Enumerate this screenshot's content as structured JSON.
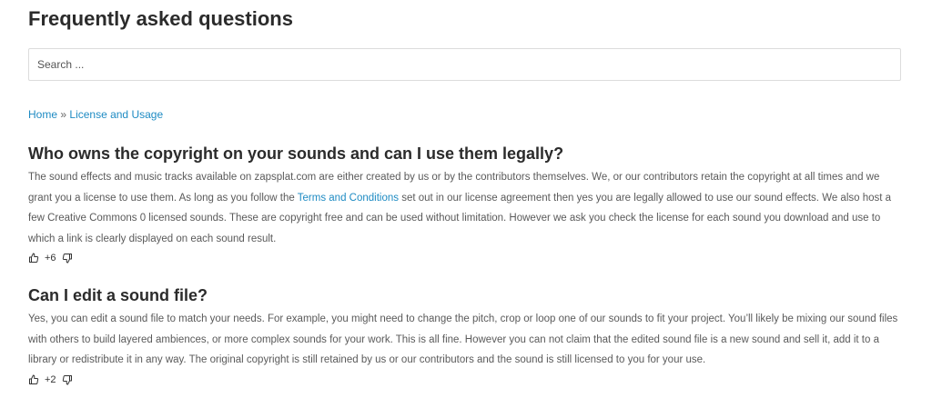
{
  "page": {
    "title": "Frequently asked questions"
  },
  "search": {
    "placeholder": "Search ..."
  },
  "breadcrumb": {
    "home": "Home",
    "separator": "»",
    "current": "License and Usage"
  },
  "faqs": [
    {
      "question": "Who owns the copyright on your sounds and can I use them legally?",
      "answer_part1": "The sound effects and music tracks available on zapsplat.com are either created by us or by the contributors themselves. We, or our contributors retain the copyright at all times and we grant you a license to use them. As long as you follow the ",
      "answer_link": "Terms and Conditions",
      "answer_part2": " set out in our license agreement then yes you are legally allowed to use our sound effects. We also host a few Creative Commons 0 licensed sounds. These are copyright free and can be used without limitation. However we ask you check the license for each sound you download and use to which a link is clearly displayed on each sound result.",
      "votes": "+6"
    },
    {
      "question": "Can I edit a sound file?",
      "answer": "Yes, you can edit a sound file to match your needs. For example, you might need to change the pitch, crop or loop one of our sounds to fit your project. You’ll likely be mixing our sound files with others to build layered ambiences, or more complex sounds for your work. This is all fine. However you can not claim that the edited sound file is a new sound and sell it, add it to a library or redistribute it in any way. The original copyright is still retained by us or our contributors and the sound is still licensed to you for your use.",
      "votes": "+2"
    }
  ],
  "icons": {
    "upvote": "thumbs-up-icon",
    "downvote": "thumbs-down-icon"
  },
  "colors": {
    "link": "#1e8bc3",
    "heading": "#2b2b2b",
    "body_text": "#5a5a5a"
  }
}
